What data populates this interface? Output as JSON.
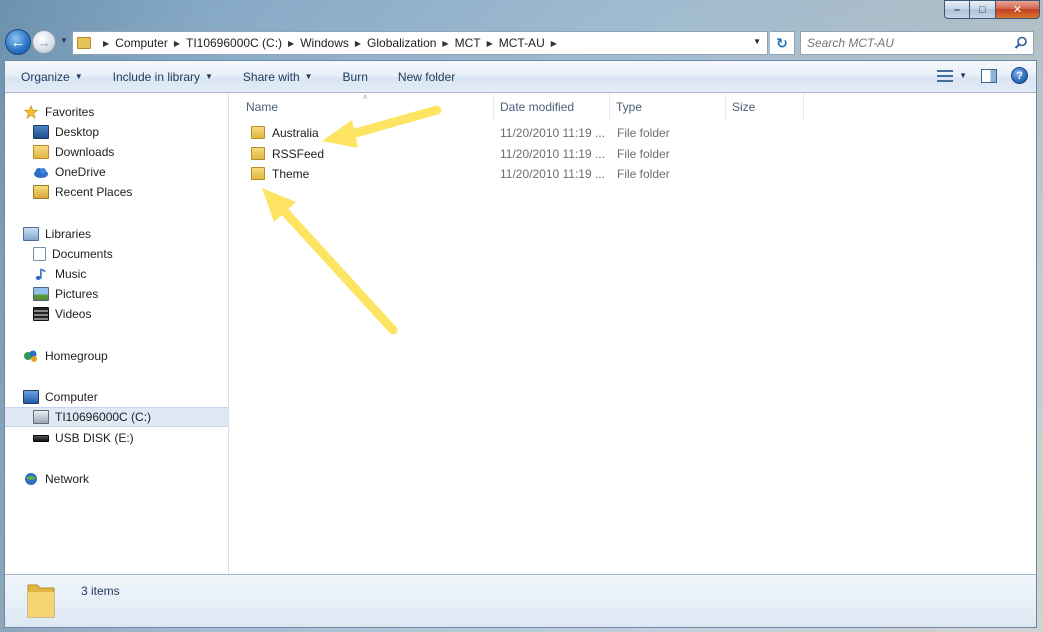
{
  "window": {
    "caption": {
      "minimize": "–",
      "maximize": "□",
      "close": "✕"
    }
  },
  "nav": {
    "back_icon": "back-arrow-icon",
    "forward_icon": "forward-arrow-icon",
    "breadcrumbs": [
      "Computer",
      "TI10696000C (C:)",
      "Windows",
      "Globalization",
      "MCT",
      "MCT-AU"
    ],
    "search_placeholder": "Search MCT-AU"
  },
  "toolbar": {
    "organize": "Organize",
    "include_in_library": "Include in library",
    "share_with": "Share with",
    "burn": "Burn",
    "new_folder": "New folder"
  },
  "sidebar": {
    "items": [
      {
        "label": "Favorites",
        "icon": "star-icon",
        "kind": "group"
      },
      {
        "label": "Desktop",
        "icon": "desktop-icon",
        "kind": "item"
      },
      {
        "label": "Downloads",
        "icon": "downloads-icon",
        "kind": "item"
      },
      {
        "label": "OneDrive",
        "icon": "cloud-icon",
        "kind": "item"
      },
      {
        "label": "Recent Places",
        "icon": "recent-places-icon",
        "kind": "item"
      },
      {
        "label": "Libraries",
        "icon": "library-icon",
        "kind": "group"
      },
      {
        "label": "Documents",
        "icon": "documents-icon",
        "kind": "item"
      },
      {
        "label": "Music",
        "icon": "music-icon",
        "kind": "item"
      },
      {
        "label": "Pictures",
        "icon": "pictures-icon",
        "kind": "item"
      },
      {
        "label": "Videos",
        "icon": "videos-icon",
        "kind": "item"
      },
      {
        "label": "Homegroup",
        "icon": "homegroup-icon",
        "kind": "group"
      },
      {
        "label": "Computer",
        "icon": "computer-icon",
        "kind": "group"
      },
      {
        "label": "TI10696000C (C:)",
        "icon": "drive-icon",
        "kind": "item",
        "selected": true
      },
      {
        "label": "USB DISK (E:)",
        "icon": "usb-drive-icon",
        "kind": "item"
      },
      {
        "label": "Network",
        "icon": "network-icon",
        "kind": "group"
      }
    ]
  },
  "columns": {
    "name": "Name",
    "date_modified": "Date modified",
    "type": "Type",
    "size": "Size"
  },
  "files": [
    {
      "name": "Australia",
      "date": "11/20/2010 11:19 ...",
      "type": "File folder",
      "size": ""
    },
    {
      "name": "RSSFeed",
      "date": "11/20/2010 11:19 ...",
      "type": "File folder",
      "size": ""
    },
    {
      "name": "Theme",
      "date": "11/20/2010 11:19 ...",
      "type": "File folder",
      "size": ""
    }
  ],
  "status": {
    "count": "3 items"
  },
  "colors": {
    "annotation_arrow": "#fde462",
    "selection": "#dfe9f5",
    "accent": "#1f5fae"
  }
}
